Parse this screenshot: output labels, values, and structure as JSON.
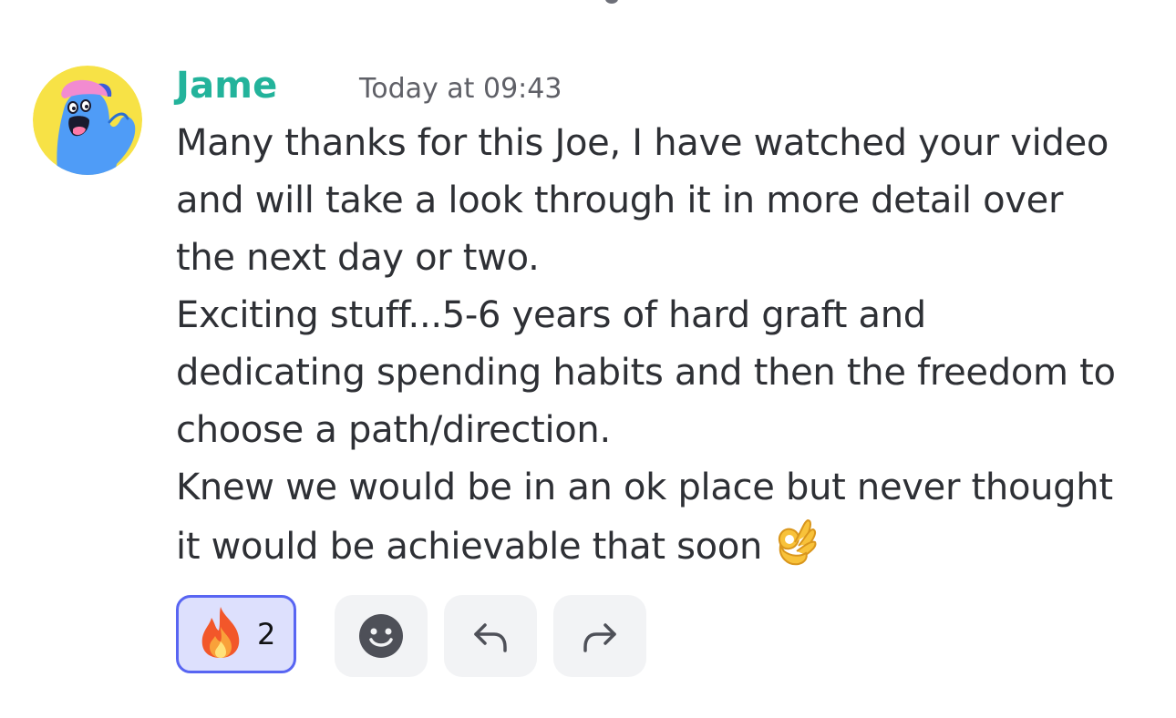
{
  "message": {
    "author": "Jame",
    "timestamp": "Today at 09:43",
    "lines": [
      "Many thanks for this Joe, I have watched your video",
      "and will take a look through it in more detail over",
      "the next day or two.",
      "Exciting stuff...5-6 years of hard graft and",
      "dedicating spending habits and then the freedom to",
      "choose a path/direction.",
      "Knew we would be in an ok place but never thought",
      "it would be achievable that soon"
    ],
    "trailing_emoji": "ok-hand"
  },
  "reactions": [
    {
      "emoji": "fire",
      "count": "2",
      "selected": true
    }
  ],
  "actions": [
    "add-reaction",
    "reply",
    "forward"
  ],
  "colors": {
    "author": "#23b39b",
    "reaction_border": "#5865f2",
    "reaction_bg": "#dde0fd",
    "button_bg": "#f2f3f5",
    "avatar_bg": "#f7e246",
    "avatar_body": "#4f9cf7"
  }
}
